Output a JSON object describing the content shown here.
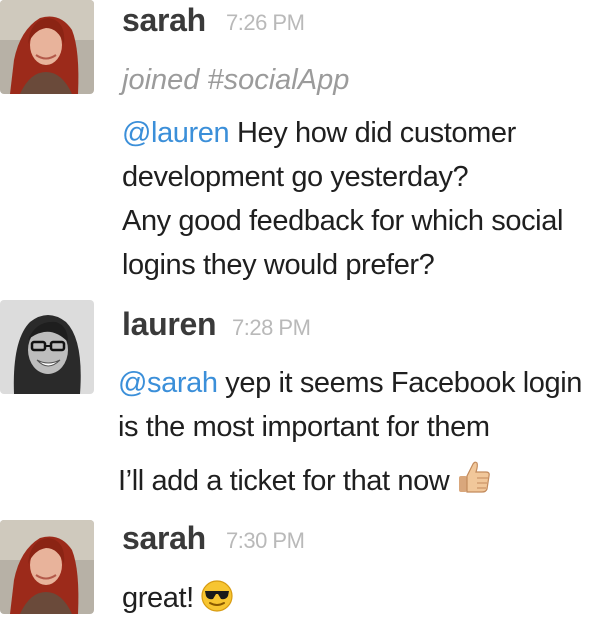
{
  "messages": [
    {
      "user": "sarah",
      "time": "7:26 PM",
      "system": "joined #socialApp",
      "mention": "@lauren",
      "lines": [
        "Hey how did customer",
        "development go yesterday?",
        "Any good feedback for which social",
        "logins they would prefer?"
      ]
    },
    {
      "user": "lauren",
      "time": "7:28 PM",
      "mention": "@sarah",
      "lines": [
        "yep it seems Facebook login",
        "is the most important for them",
        "I’ll add a ticket for that now"
      ],
      "emoji": "thumbs-up-emoji"
    },
    {
      "user": "sarah",
      "time": "7:30 PM",
      "lines": [
        "great!"
      ],
      "emoji": "sunglasses-emoji"
    }
  ],
  "colors": {
    "mention": "#3b8fd9",
    "timestamp": "#b9b9b9",
    "system": "#9b9b9b",
    "username": "#3a3a3a",
    "text": "#1f1f1f"
  }
}
